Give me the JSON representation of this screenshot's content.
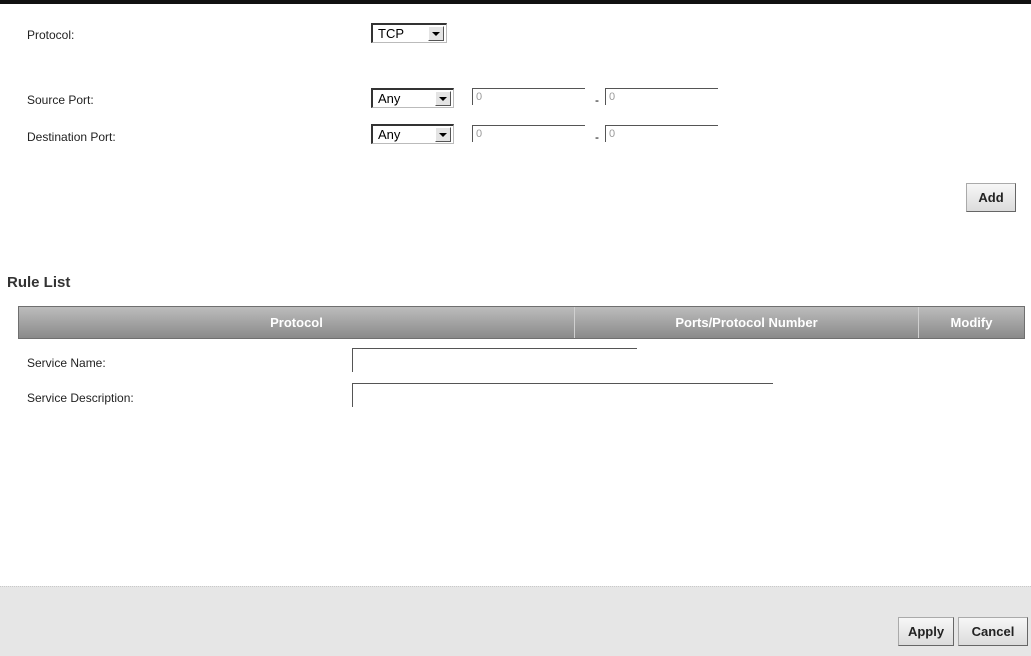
{
  "form": {
    "protocol_label": "Protocol:",
    "protocol_value": "TCP",
    "source_port_label": "Source Port:",
    "source_port_select": "Any",
    "source_port_start": "0",
    "source_port_end": "0",
    "dest_port_label": "Destination Port:",
    "dest_port_select": "Any",
    "dest_port_start": "0",
    "dest_port_end": "0",
    "range_separator": "-",
    "add_label": "Add"
  },
  "rule_list": {
    "title": "Rule List",
    "columns": [
      "Protocol",
      "Ports/Protocol Number",
      "Modify"
    ]
  },
  "service": {
    "name_label": "Service Name:",
    "name_value": "",
    "description_label": "Service Description:",
    "description_value": ""
  },
  "footer": {
    "apply_label": "Apply",
    "cancel_label": "Cancel"
  }
}
